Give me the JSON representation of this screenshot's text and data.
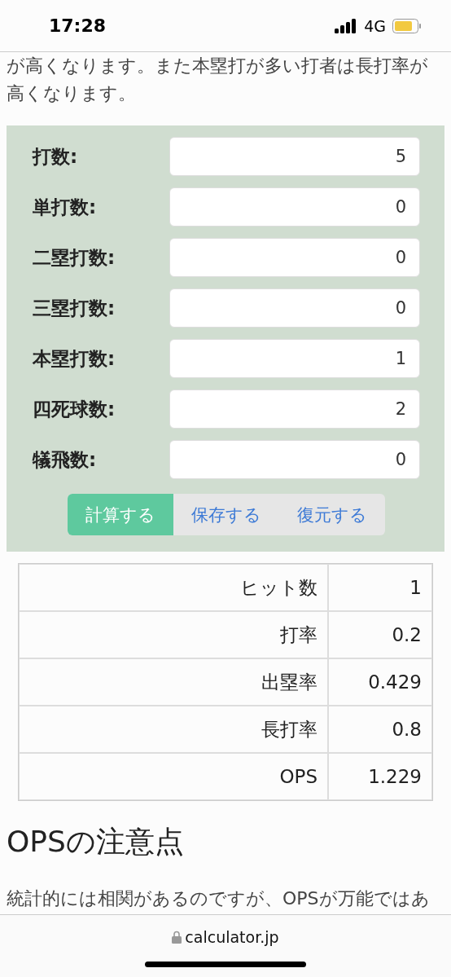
{
  "status_bar": {
    "time": "17:28",
    "network": "4G"
  },
  "intro": "が高くなります。また本塁打が多い打者は長打率が高くなります。",
  "form": {
    "fields": [
      {
        "label": "打数:",
        "value": "5"
      },
      {
        "label": "単打数:",
        "value": "0"
      },
      {
        "label": "二塁打数:",
        "value": "0"
      },
      {
        "label": "三塁打数:",
        "value": "0"
      },
      {
        "label": "本塁打数:",
        "value": "1"
      },
      {
        "label": "四死球数:",
        "value": "2"
      },
      {
        "label": "犠飛数:",
        "value": "0"
      }
    ],
    "buttons": [
      {
        "label": "計算する",
        "kind": "primary"
      },
      {
        "label": "保存する",
        "kind": "link"
      },
      {
        "label": "復元する",
        "kind": "link"
      }
    ]
  },
  "results": [
    {
      "name": "ヒット数",
      "value": "1"
    },
    {
      "name": "打率",
      "value": "0.2"
    },
    {
      "name": "出塁率",
      "value": "0.429"
    },
    {
      "name": "長打率",
      "value": "0.8"
    },
    {
      "name": "OPS",
      "value": "1.229"
    }
  ],
  "section": {
    "heading": "OPSの注意点",
    "text": "統計的には相関があるのですが、OPSが万能ではあ"
  },
  "browser": {
    "url": "calculator.jp"
  }
}
